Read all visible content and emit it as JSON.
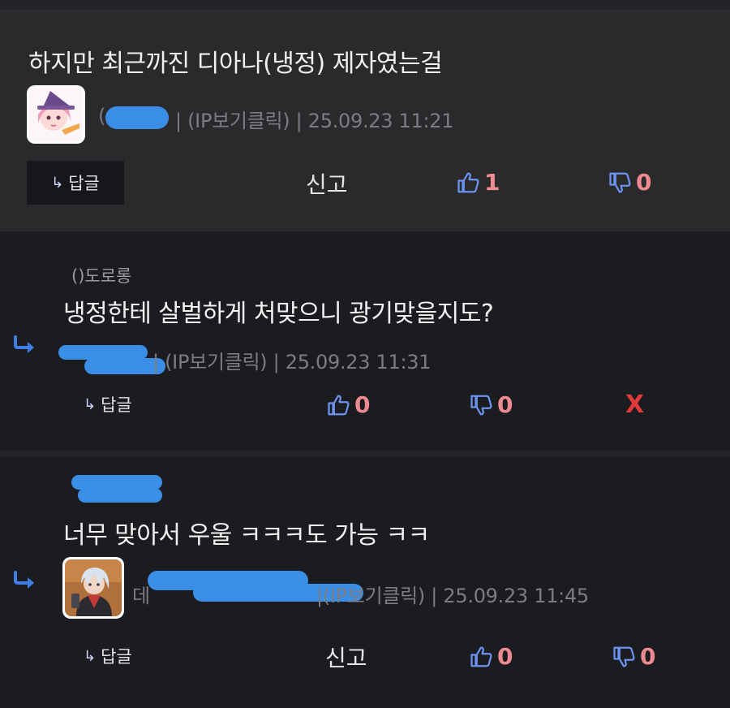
{
  "comments": [
    {
      "text": "하지만 최근까진 디아나(냉정) 제자였는걸",
      "author_prefix": "(",
      "meta": "| (IP보기클릭) | 25.09.23 11:21",
      "reply_label": "답글",
      "report_label": "신고",
      "likes": "1",
      "dislikes": "0"
    },
    {
      "mention": "()도로롱",
      "text": "냉정한테 살벌하게 처맞으니 광기맞을지도?",
      "author_prefix": "",
      "meta": "| (IP보기클릭) | 25.09.23 11:31",
      "reply_label": "답글",
      "likes": "0",
      "dislikes": "0",
      "delete_label": "X"
    },
    {
      "mention": "",
      "text": "너무 맞아서 우울 ㅋㅋㅋ도 가능 ㅋㅋ",
      "author_prefix": "데",
      "meta": "|(IP보기클릭) | 25.09.23 11:45",
      "reply_label": "답글",
      "report_label": "신고",
      "likes": "0",
      "dislikes": "0"
    }
  ],
  "icons": {
    "reply": "reply-arrow-icon",
    "like": "thumbs-up-icon",
    "dislike": "thumbs-down-icon",
    "nested": "nested-reply-icon"
  },
  "colors": {
    "accent_icon": "#6d93f0",
    "count": "#ee8a92",
    "delete": "#e03a3a",
    "redaction": "#3a8ee6"
  }
}
